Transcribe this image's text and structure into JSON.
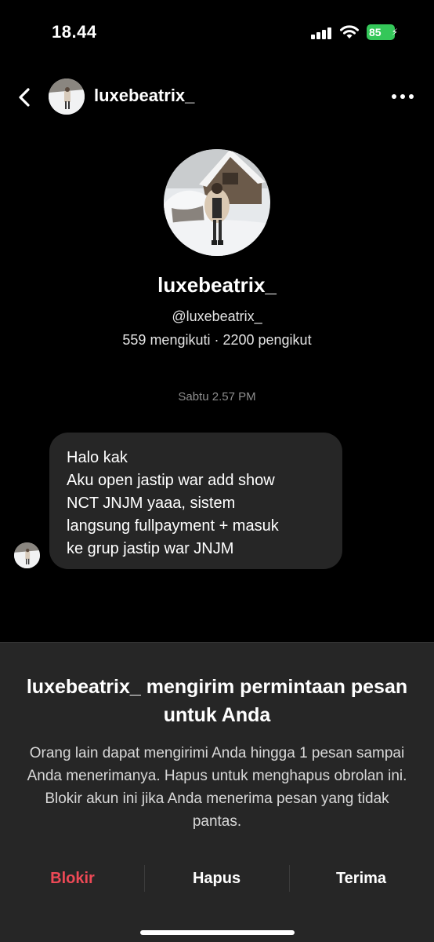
{
  "status_bar": {
    "time": "18.44",
    "battery": "85",
    "icons": [
      "signal-icon",
      "wifi-icon",
      "battery-icon"
    ]
  },
  "header": {
    "username": "luxebeatrix_",
    "icons": [
      "back-arrow-icon",
      "more-options-icon"
    ]
  },
  "profile": {
    "name": "luxebeatrix_",
    "handle": "@luxebeatrix_",
    "stats": "559 mengikuti · 2200 pengikut"
  },
  "conversation": {
    "timestamp": "Sabtu 2.57 PM",
    "message_lines": [
      "Halo kak",
      "Aku open jastip war add show",
      "NCT JNJM yaaa, sistem",
      "langsung fullpayment + masuk",
      "ke grup jastip war JNJM"
    ]
  },
  "request": {
    "title": "luxebeatrix_ mengirim permintaan pesan untuk Anda",
    "body": "Orang lain dapat mengirimi Anda hingga 1 pesan sampai Anda menerimanya. Hapus untuk menghapus obrolan ini. Blokir akun ini jika Anda menerima pesan yang tidak pantas.",
    "actions": {
      "block": "Blokir",
      "delete": "Hapus",
      "accept": "Terima"
    }
  },
  "colors": {
    "background": "#000000",
    "sheet": "#262626",
    "bubble": "#262626",
    "block_red": "#ed4956",
    "battery_green": "#34c759"
  }
}
